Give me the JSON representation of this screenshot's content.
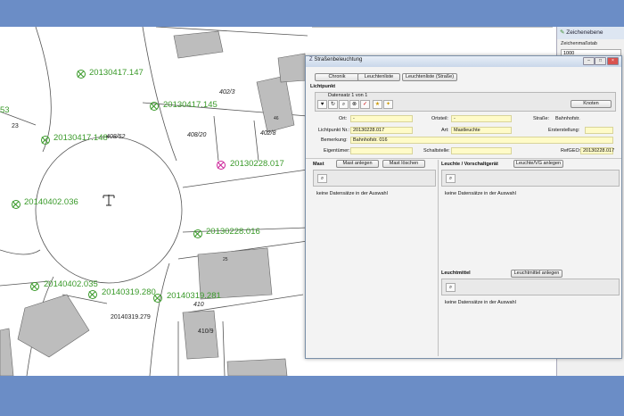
{
  "map": {
    "lamps": [
      {
        "label": "20130417.147"
      },
      {
        "label": "20130417.145"
      },
      {
        "label": "20130417.148"
      },
      {
        "label": "20130228.017"
      },
      {
        "label": "20140402.036"
      },
      {
        "label": "20130228.016"
      },
      {
        "label": "20140402.035"
      },
      {
        "label": "20140319.280"
      },
      {
        "label": "20140319.281"
      },
      {
        "label": "20140319.279"
      },
      {
        "label": "53"
      }
    ],
    "parcels": {
      "p23": "23",
      "p4082": "402/3",
      "p4052": "408/52",
      "p40820": "408/20",
      "p4028": "402/8",
      "p410": "410",
      "p4109": "410/9",
      "p46": "46",
      "p25": "25"
    }
  },
  "side_panel": {
    "title": "Zeichenebene",
    "scale_label": "Zeichenmaßstab",
    "scale_value": "1000"
  },
  "dialog": {
    "title": "Straßenbeleuchtung",
    "top_buttons": [
      "Chronik",
      "Leuchtenliste",
      "Leuchtenliste (Straße)"
    ],
    "section_lichtpunkt": "Lichtpunkt",
    "datensatz": "Datensatz 1 von 1",
    "knoten_button": "Knoten",
    "fields": {
      "ort_label": "Ort:",
      "ort": "-",
      "ortsteil_label": "Ortsteil:",
      "ortsteil": "-",
      "strasse_label": "Straße:",
      "strasse": "Bahnhofstr.",
      "lichtpunkt_label": "Lichtpunkt Nr.:",
      "lichtpunkt": "20130228.017",
      "art_label": "Art:",
      "art": "Mastleuchte",
      "ersterstellung_label": "Ersterstellung:",
      "ersterstellung": "",
      "bemerkung_label": "Bemerkung:",
      "bemerkung": "Bahnhofstr. 016",
      "eigentuemer_label": "Eigentümer:",
      "eigentuemer": "",
      "schaltstelle_label": "Schaltstelle:",
      "schaltstelle": "",
      "refgeo_label": "RefGEO:",
      "refgeo": "20130228.017"
    },
    "mast": {
      "title": "Mast",
      "add": "Mast anlegen",
      "delete": "Mast löschen",
      "empty": "keine Datensätze in der Auswahl"
    },
    "leuchte": {
      "title": "Leuchte / Vorschaltgerät",
      "add": "Leuchte/VG anlegen",
      "empty": "keine Datensätze in der Auswahl"
    },
    "leuchtmittel": {
      "title": "Leuchtmittel",
      "add": "Leuchtmittel anlegen",
      "empty": "keine Datensätze in der Auswahl"
    }
  }
}
